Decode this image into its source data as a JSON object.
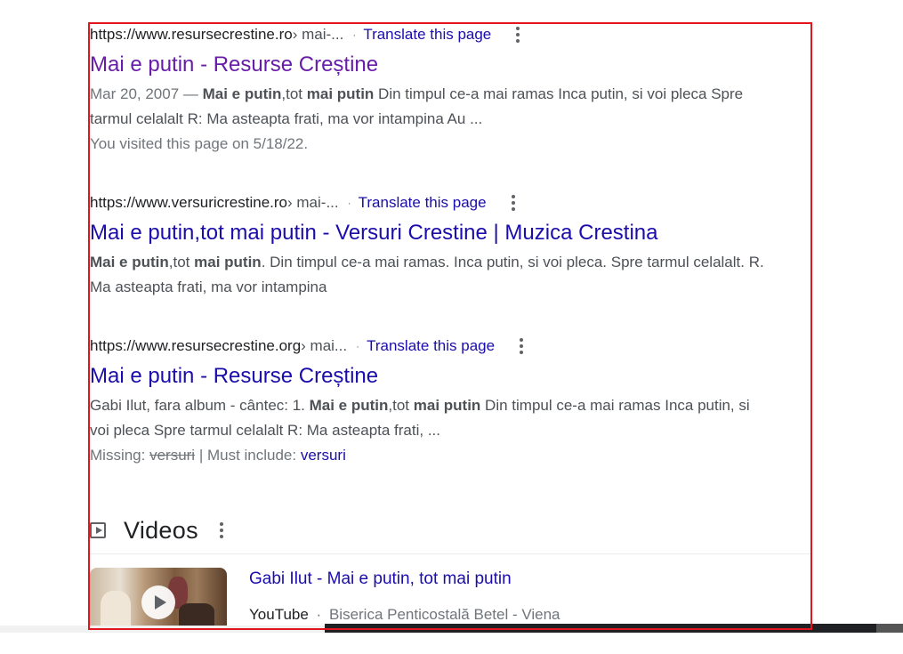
{
  "results": [
    {
      "cite_domain": "https://www.resursecrestine.ro",
      "cite_path": " › mai-...",
      "translate_label": "Translate this page",
      "title": "Mai e putin - Resurse Creștine",
      "snippet_date": "Mar 20, 2007 — ",
      "snippet_parts": [
        "Mai e putin",
        ",tot ",
        "mai putin",
        " Din timpul ce-a mai ramas Inca putin, si voi pleca Spre tarmul celalalt R: Ma asteapta frati, ma vor intampina Au ..."
      ],
      "visited_note": "You visited this page on 5/18/22."
    },
    {
      "cite_domain": "https://www.versuricrestine.ro",
      "cite_path": " › mai-...",
      "translate_label": "Translate this page",
      "title": "Mai e putin,tot mai putin - Versuri Crestine | Muzica Crestina",
      "snippet_parts": [
        "Mai e putin",
        ",tot ",
        "mai putin",
        ". Din timpul ce-a mai ramas. Inca putin, si voi pleca. Spre tarmul celalalt. R. Ma asteapta frati, ma vor intampina"
      ]
    },
    {
      "cite_domain": "https://www.resursecrestine.org",
      "cite_path": " › mai...",
      "translate_label": "Translate this page",
      "title": "Mai e putin - Resurse Creștine",
      "snippet_parts": [
        "Gabi Ilut, fara album - cântec: 1. ",
        "Mai e putin",
        ",tot ",
        "mai putin",
        " Din timpul ce-a mai ramas Inca putin, si voi pleca Spre tarmul celalalt R: Ma asteapta frati, ..."
      ],
      "missing_label": "Missing: ",
      "missing_term": "versuri",
      "must_include_label": " | Must include: ",
      "must_include_term": "versuri"
    }
  ],
  "videos": {
    "heading": "Videos",
    "items": [
      {
        "title": "Gabi Ilut - Mai e putin, tot mai putin",
        "source": "YouTube",
        "separator": "·",
        "channel": "Biserica Penticostală Betel - Viena"
      }
    ]
  },
  "colors": {
    "link": "#1a0dab",
    "visited_link": "#681da8",
    "highlight_border": "#e3141b"
  }
}
